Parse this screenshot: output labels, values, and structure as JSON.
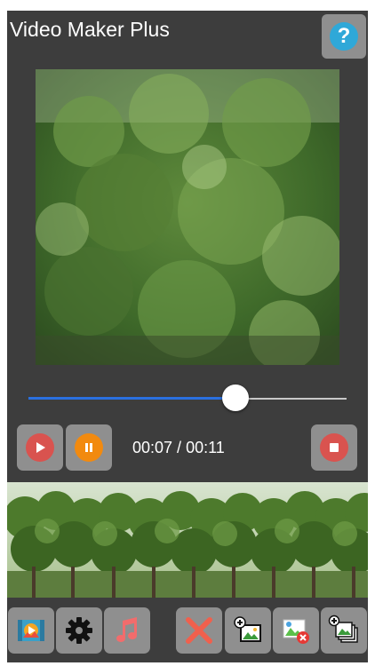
{
  "app": {
    "title": "Video Maker Plus"
  },
  "header": {
    "help_icon_glyph": "?"
  },
  "player": {
    "progress": 0.65,
    "current_time": "00:07",
    "separator": " / ",
    "total_time": "00:11"
  },
  "colors": {
    "background": "#3d3d3d",
    "button": "#8f8f8f",
    "accent_blue": "#2a70e0",
    "play_red": "#d9534f",
    "pause_orange": "#f28a0f",
    "help_blue": "#2fa8d8"
  },
  "icons": {
    "help": "question-mark-icon",
    "play": "play-icon",
    "pause": "pause-icon",
    "stop": "stop-icon",
    "media": "video-clip-icon",
    "settings": "gear-icon",
    "music": "music-note-icon",
    "delete": "close-x-icon",
    "add_image": "add-image-icon",
    "remove_image": "remove-image-icon",
    "add_multiple": "add-multiple-images-icon"
  }
}
